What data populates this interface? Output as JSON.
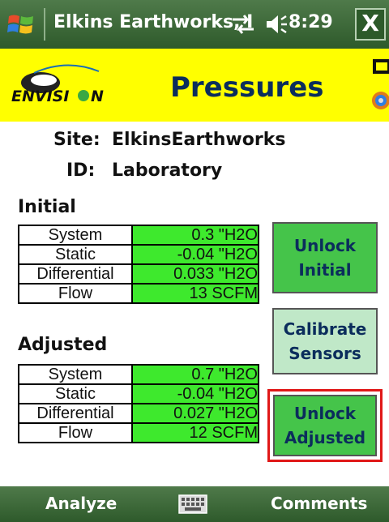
{
  "titlebar": {
    "title": "Elkins Earthworks, I",
    "time": "8:29",
    "close_label": "X"
  },
  "header": {
    "page_title": "Pressures"
  },
  "info": {
    "site_label": "Site:",
    "site_value": "ElkinsEarthworks",
    "id_label": "ID:",
    "id_value": "Laboratory"
  },
  "initial": {
    "title": "Initial",
    "rows": [
      {
        "name": "System",
        "value": "0.3  \"H2O"
      },
      {
        "name": "Static",
        "value": "-0.04 \"H2O"
      },
      {
        "name": "Differential",
        "value": "0.033 \"H2O"
      },
      {
        "name": "Flow",
        "value": "13 SCFM"
      }
    ]
  },
  "adjusted": {
    "title": "Adjusted",
    "rows": [
      {
        "name": "System",
        "value": "0.7  \"H2O"
      },
      {
        "name": "Static",
        "value": "-0.04 \"H2O"
      },
      {
        "name": "Differential",
        "value": "0.027 \"H2O"
      },
      {
        "name": "Flow",
        "value": "12 SCFM"
      }
    ]
  },
  "buttons": {
    "unlock_initial": {
      "line1": "Unlock",
      "line2": "Initial"
    },
    "calibrate": {
      "line1": "Calibrate",
      "line2": "Sensors"
    },
    "unlock_adjusted": {
      "line1": "Unlock",
      "line2": "Adjusted"
    }
  },
  "softkeys": {
    "left": "Analyze",
    "right": "Comments"
  },
  "logo_text": "ENVISION",
  "colors": {
    "title_bar": "#2e5a2b",
    "header": "#ffff00",
    "value_cell": "#3ee92d",
    "button": "#45c44a",
    "selected_border": "#e01818"
  }
}
